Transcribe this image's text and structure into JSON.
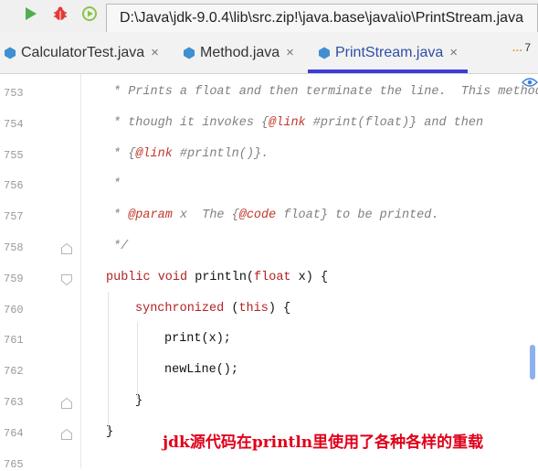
{
  "toolbar": {
    "icons": [
      "run-icon",
      "debug-icon",
      "coverage-icon"
    ],
    "path_tooltip": "D:\\Java\\jdk-9.0.4\\lib\\src.zip!\\java.base\\java\\io\\PrintStream.java"
  },
  "tabs": [
    {
      "label": "CalculatorTest.java",
      "close": "×",
      "active": false
    },
    {
      "label": "Method.java",
      "close": "×",
      "active": false
    },
    {
      "label": "PrintStream.java",
      "close": "×",
      "active": true
    }
  ],
  "overflow": {
    "count": "7"
  },
  "colors": {
    "accent": "#3d3dd7",
    "keyword": "#b22222",
    "annotation": "#e0001a",
    "comment": "#808080"
  },
  "editor": {
    "lines": [
      {
        "num": "753",
        "parts": [
          {
            "t": "* Prints a float and then terminate the line.  This method",
            "c": "cmt"
          }
        ]
      },
      {
        "num": "754",
        "parts": [
          {
            "t": "* though it invokes {",
            "c": "cmt"
          },
          {
            "t": "@link",
            "c": "tag"
          },
          {
            "t": " #print(float)} and then",
            "c": "cmt"
          }
        ]
      },
      {
        "num": "755",
        "parts": [
          {
            "t": "* {",
            "c": "cmt"
          },
          {
            "t": "@link",
            "c": "tag"
          },
          {
            "t": " #println()}.",
            "c": "cmt"
          }
        ]
      },
      {
        "num": "756",
        "parts": [
          {
            "t": "*",
            "c": "cmt"
          }
        ]
      },
      {
        "num": "757",
        "parts": [
          {
            "t": "* ",
            "c": "cmt"
          },
          {
            "t": "@param",
            "c": "tag"
          },
          {
            "t": " x  The {",
            "c": "cmt"
          },
          {
            "t": "@code",
            "c": "tag"
          },
          {
            "t": " float} to be printed.",
            "c": "cmt"
          }
        ]
      },
      {
        "num": "758",
        "parts": [
          {
            "t": "*/",
            "c": "cmt"
          }
        ]
      },
      {
        "num": "759",
        "parts": [
          {
            "t": "public void ",
            "c": "kw"
          },
          {
            "t": "println(",
            "c": ""
          },
          {
            "t": "float ",
            "c": "kw"
          },
          {
            "t": "x) {",
            "c": ""
          }
        ]
      },
      {
        "num": "760",
        "parts": [
          {
            "t": "synchronized ",
            "c": "kw"
          },
          {
            "t": "(",
            "c": ""
          },
          {
            "t": "this",
            "c": "kw"
          },
          {
            "t": ") {",
            "c": ""
          }
        ]
      },
      {
        "num": "761",
        "parts": [
          {
            "t": "print(x);",
            "c": ""
          }
        ]
      },
      {
        "num": "762",
        "parts": [
          {
            "t": "newLine();",
            "c": ""
          }
        ]
      },
      {
        "num": "763",
        "parts": [
          {
            "t": "}",
            "c": ""
          }
        ]
      },
      {
        "num": "764",
        "parts": [
          {
            "t": "}",
            "c": ""
          }
        ]
      },
      {
        "num": "765",
        "parts": []
      }
    ]
  },
  "annotation": {
    "text": "jdk源代码在println里使用了各种各样的重载"
  }
}
